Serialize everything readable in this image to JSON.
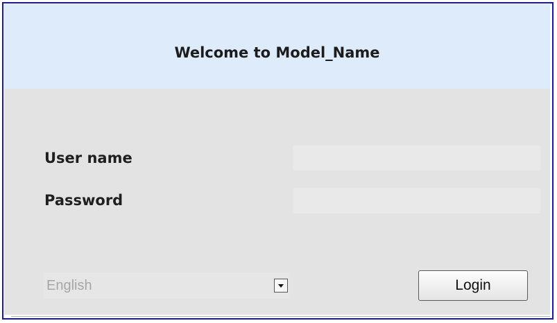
{
  "header": {
    "title": "Welcome to Model_Name"
  },
  "form": {
    "username_label": "User name",
    "username_value": "",
    "password_label": "Password",
    "password_value": ""
  },
  "language": {
    "selected": "English",
    "dropdown_icon": "triangle-down-icon"
  },
  "actions": {
    "login_label": "Login"
  },
  "colors": {
    "frame_border": "#1515b8",
    "header_bg": "#deebfb",
    "panel_bg": "#e3e3e3"
  }
}
